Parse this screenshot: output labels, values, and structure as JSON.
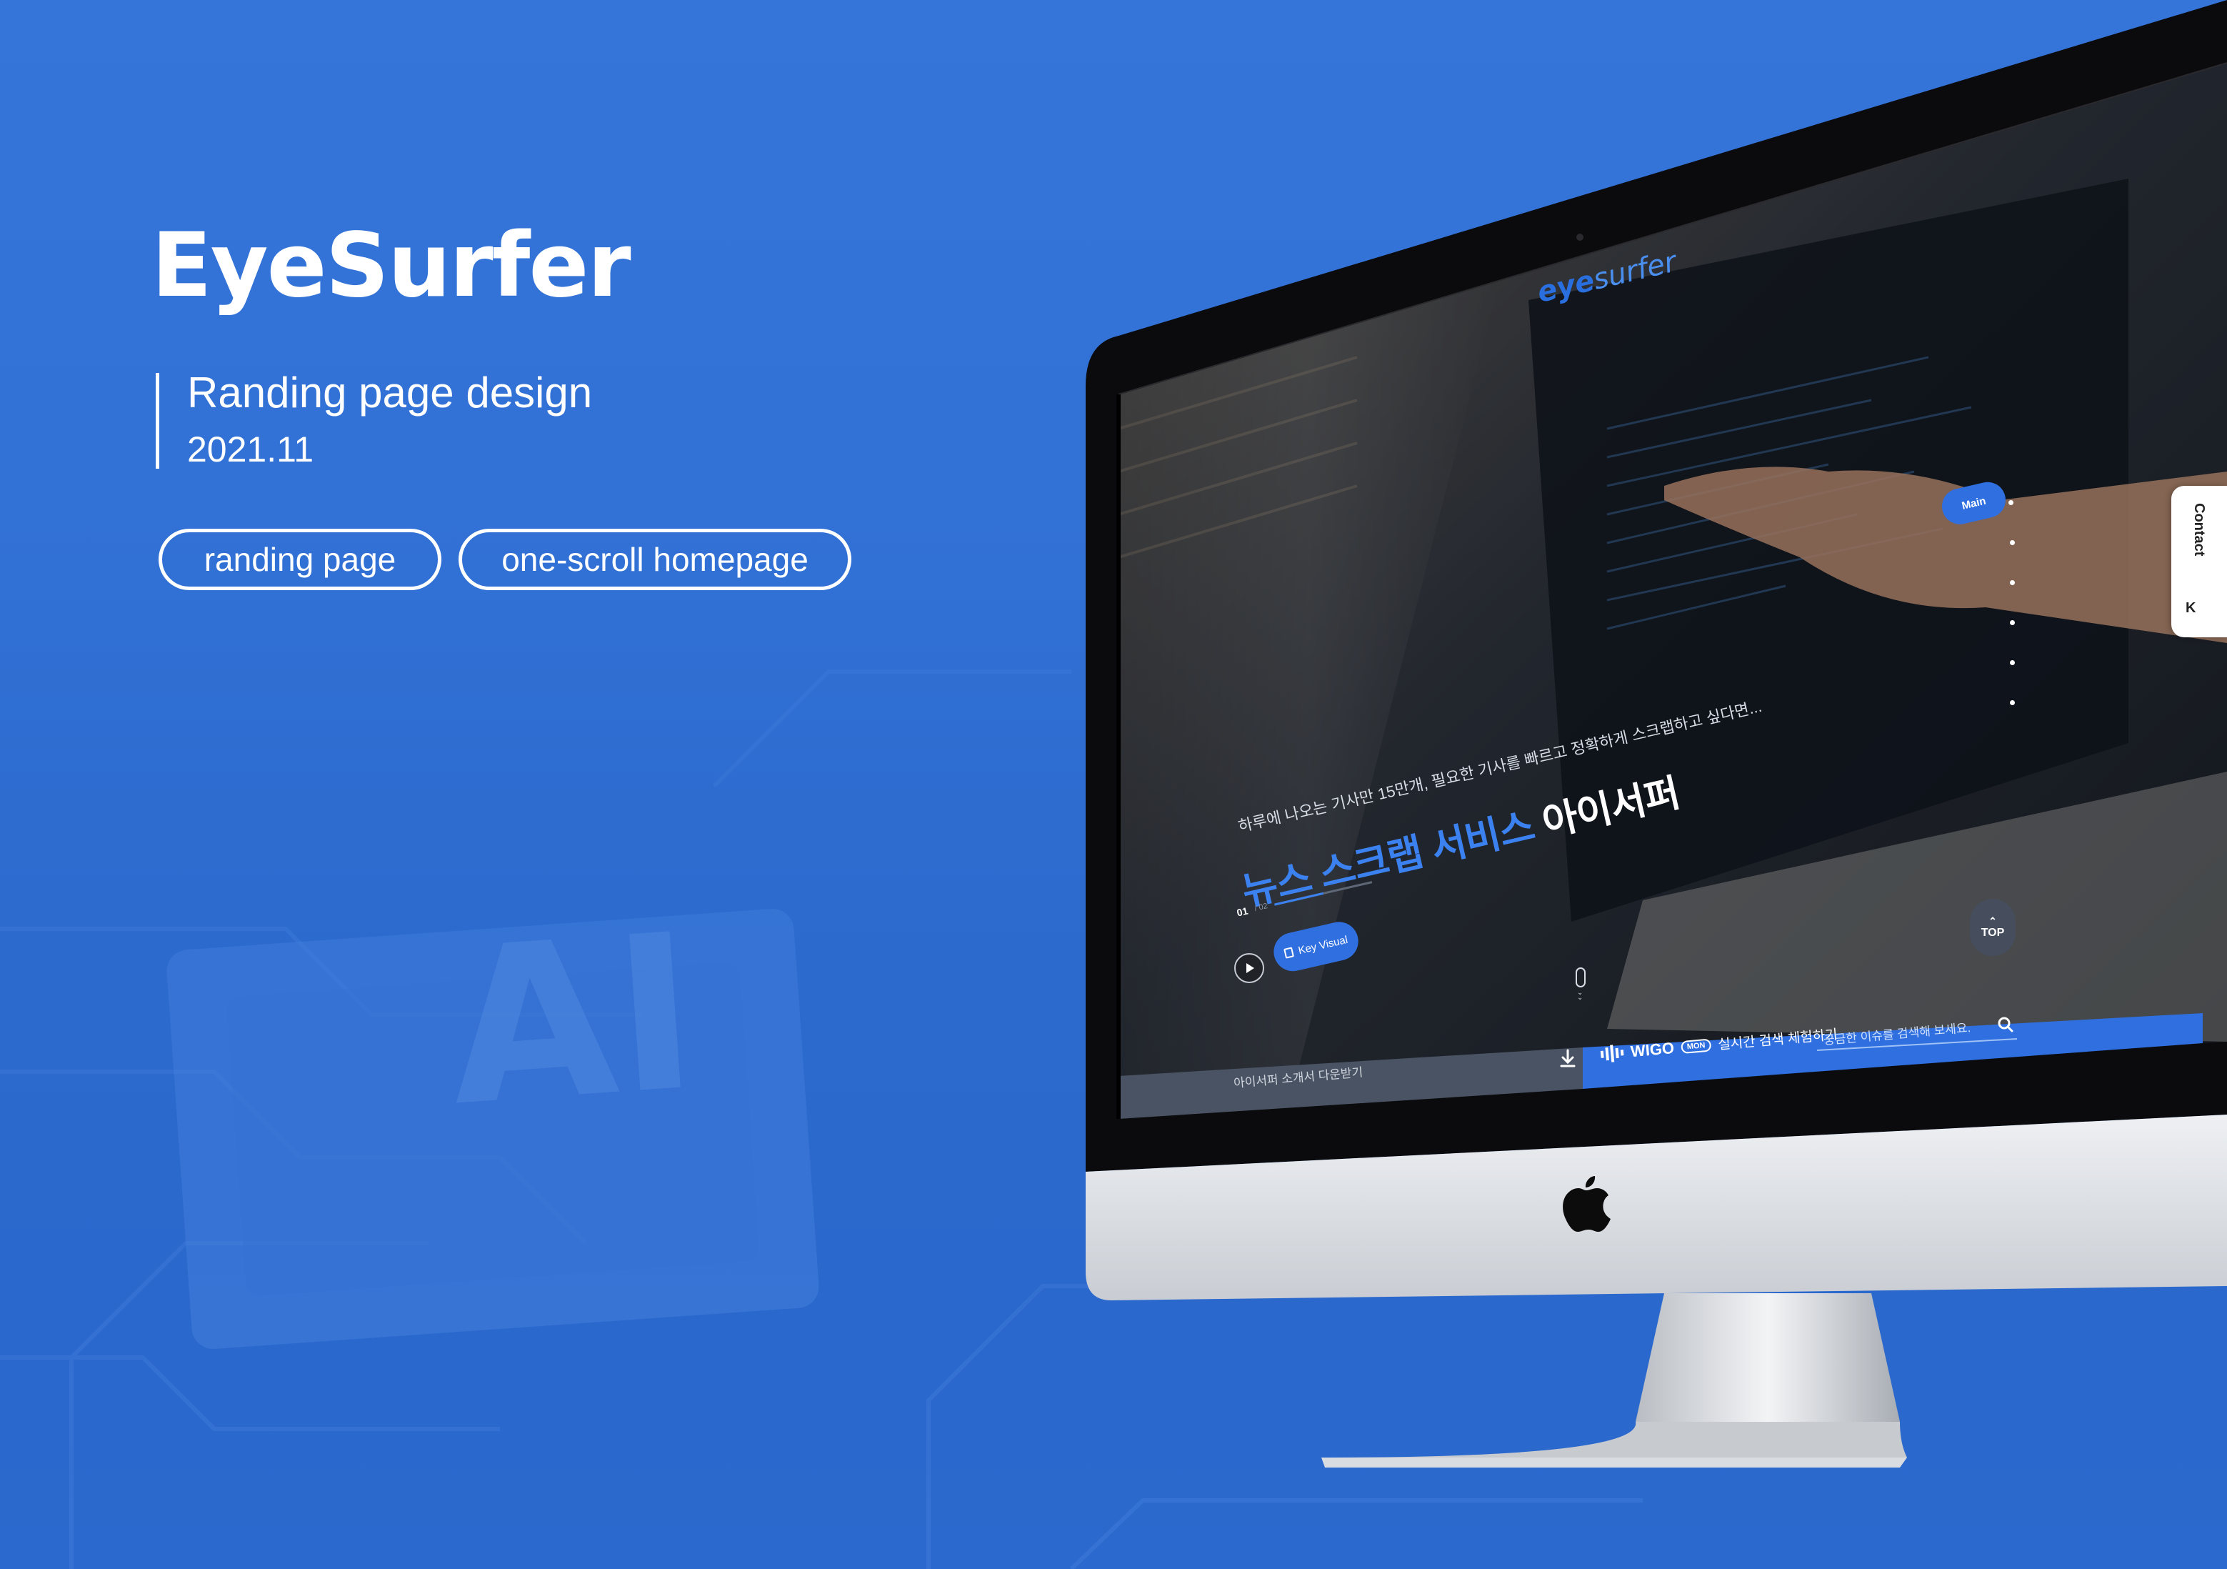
{
  "brand": {
    "title": "EyeSurfer",
    "subtitle": "Randing page design",
    "date": "2021.11",
    "tags": [
      "randing page",
      "one-scroll homepage"
    ]
  },
  "colors": {
    "background": "#3575d9",
    "accent": "#2f6fe0",
    "screen_dark": "#1d2430",
    "bar_gray": "#4a5364"
  },
  "site": {
    "logo_part1": "eye",
    "logo_part2": "surfer",
    "hero_lead": "하루에 나오는 기사만 15만개, 필요한 기사를 빠르고 정확하게 스크랩하고 싶다면...",
    "hero_headline_blue": "뉴스 스크랩 서비스",
    "hero_headline_white": "아이서퍼",
    "slide_current": "01",
    "slide_total": "/ 02",
    "key_visual_label": "Key Visual",
    "nav_active_label": "Main",
    "contact_label": "Contact",
    "contact_arrow": "K",
    "top_button_label": "TOP",
    "download_label": "아이서퍼 소개서 다운받기",
    "wigo_word": "WIGO",
    "wigo_badge": "MON",
    "wigo_desc": "실시간 검색 체험하기",
    "search_placeholder": "궁금한 이슈를 검색해 보세요."
  },
  "icons": {
    "play": "play-icon",
    "document": "document-icon",
    "download": "download-icon",
    "search": "search-icon",
    "apple": "apple-logo-icon",
    "scroll": "mouse-scroll-icon"
  }
}
